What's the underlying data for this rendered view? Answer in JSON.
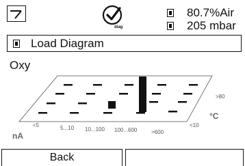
{
  "header": {
    "mode_icon": "measurement-mode-icon",
    "diag_icon": "diag-check-icon",
    "diag_label": "diag",
    "status": [
      {
        "icon": "sensor-indicator-icon",
        "value": "80.7%Air"
      },
      {
        "icon": "sensor-indicator-icon",
        "value": "205 mbar"
      }
    ]
  },
  "menu": {
    "icon": "sensor-indicator-icon",
    "label": "Load Diagram"
  },
  "section_title": "Oxy",
  "chart_data": {
    "type": "heatmap",
    "title": "",
    "x_axis": {
      "label": "nA",
      "ticks": [
        "<5",
        "5...10",
        "10...100",
        "100...600",
        ">600"
      ]
    },
    "y_axis": {
      "label": "°C",
      "ticks": [
        "<10",
        ">80"
      ]
    },
    "cells": [
      {
        "x": "100...600",
        "y": "mid",
        "value": "high"
      },
      {
        "x": "10...100",
        "y": "low",
        "value": "point"
      }
    ]
  },
  "softkeys": {
    "left": "Back",
    "right": ""
  }
}
